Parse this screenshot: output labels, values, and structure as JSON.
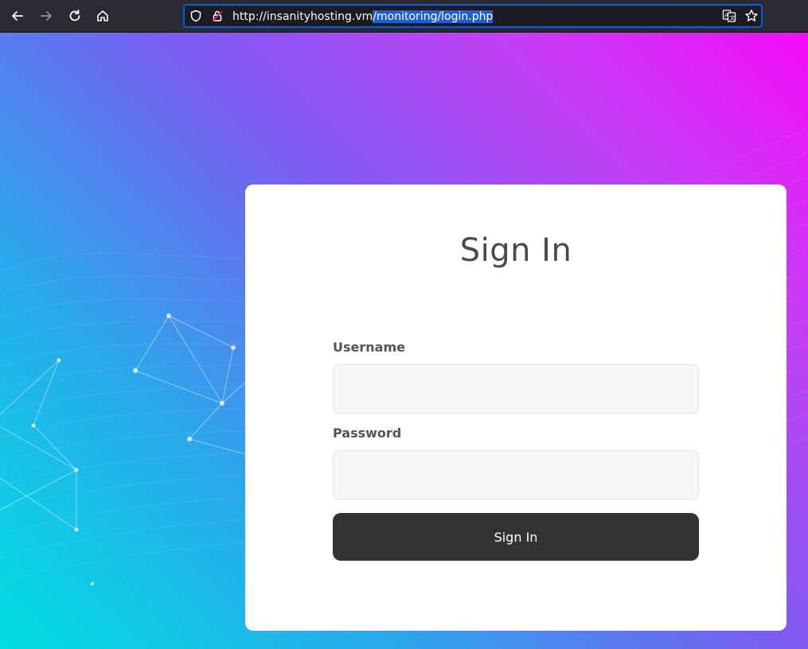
{
  "browser": {
    "url_base": "http://insanityhosting.vm",
    "url_selected": "/monitoring/login.php",
    "icons": {
      "back": "back-arrow-icon",
      "forward": "forward-arrow-icon",
      "reload": "reload-icon",
      "home": "home-icon",
      "shield": "tracking-protection-shield-icon",
      "lock": "insecure-lock-icon",
      "translate": "translate-icon",
      "bookmark": "bookmark-star-icon"
    }
  },
  "login": {
    "title": "Sign In",
    "username_label": "Username",
    "username_value": "",
    "password_label": "Password",
    "password_value": "",
    "submit_label": "Sign In"
  },
  "colors": {
    "accent_url_selection": "#1a5fd3",
    "button_bg": "#333333",
    "gradient_start": "#00dfe0",
    "gradient_end": "#f40cf8"
  }
}
